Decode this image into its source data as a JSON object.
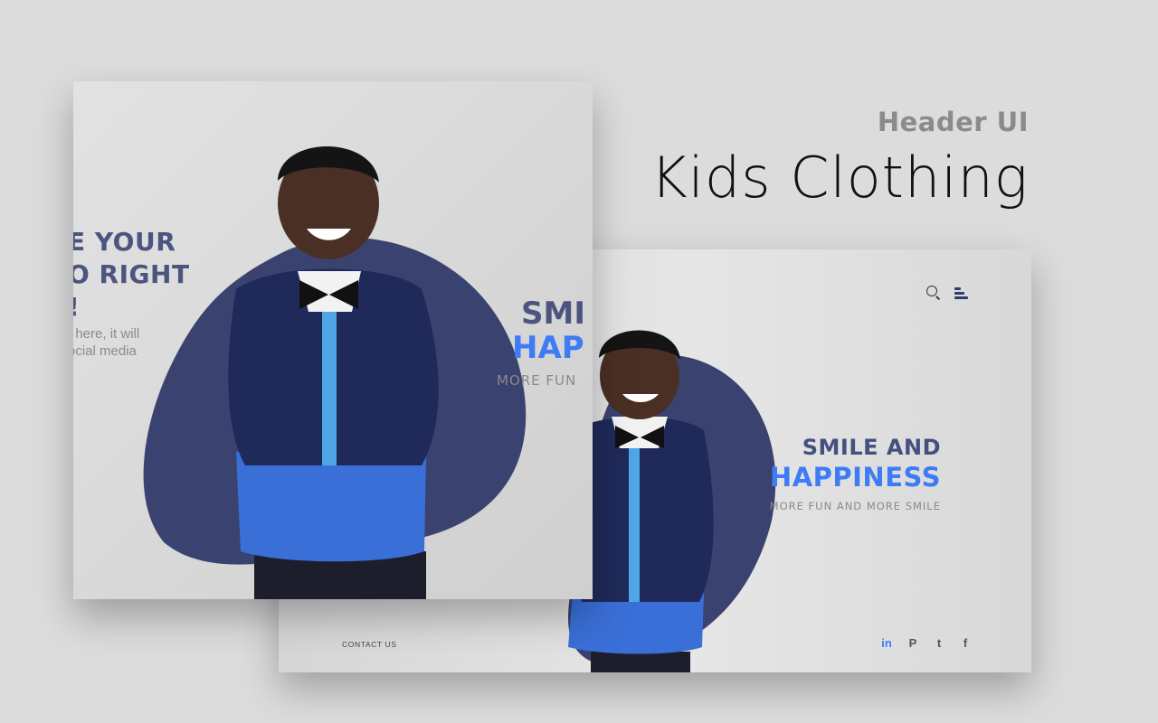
{
  "heading": {
    "eyebrow": "Header UI",
    "title": "Kids Clothing"
  },
  "back_card": {
    "hero_line1": "SMILE AND",
    "hero_line2": "HAPPINESS",
    "hero_sub": "MORE FUN AND MORE SMILE",
    "contact": "CONTACT US",
    "social": [
      "in",
      "P",
      "t",
      "f"
    ],
    "nav_icons": [
      "search-icon",
      "menu-icon"
    ]
  },
  "front_card": {
    "left_lines": [
      "E YOUR",
      "O RIGHT",
      "!"
    ],
    "left_body": [
      "t here, it will",
      "ocial media"
    ],
    "right_line1": "SMI",
    "right_line2": "HAP",
    "right_sub": "MORE FUN"
  },
  "colors": {
    "background": "#dcdcdc",
    "navy": "#44507f",
    "blob": "#3a4370",
    "accent_blue": "#3d7cf5"
  }
}
